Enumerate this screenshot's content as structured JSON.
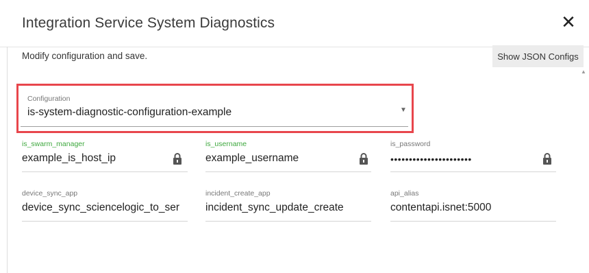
{
  "dialog": {
    "title": "Integration Service System Diagnostics",
    "close_icon": "close-icon",
    "close_glyph": "✕",
    "subtitle": "Modify configuration and save.",
    "json_button": "Show JSON Configs",
    "scroll_up_glyph": "▲"
  },
  "configuration": {
    "label": "Configuration",
    "value": "is-system-diagnostic-configuration-example",
    "dropdown_glyph": "▼",
    "highlight_color": "#e8464c"
  },
  "fields": {
    "swarm_manager": {
      "label": "is_swarm_manager",
      "value": "example_is_host_ip",
      "label_color": "#3ea83e"
    },
    "username": {
      "label": "is_username",
      "value": "example_username",
      "label_color": "#3ea83e"
    },
    "password": {
      "label": "is_password",
      "value": "••••••••••••••••••••••"
    },
    "device_sync_app": {
      "label": "device_sync_app",
      "value": "device_sync_sciencelogic_to_ser"
    },
    "incident_create_app": {
      "label": "incident_create_app",
      "value": "incident_sync_update_create"
    },
    "api_alias": {
      "label": "api_alias",
      "value": "contentapi.isnet:5000"
    }
  }
}
